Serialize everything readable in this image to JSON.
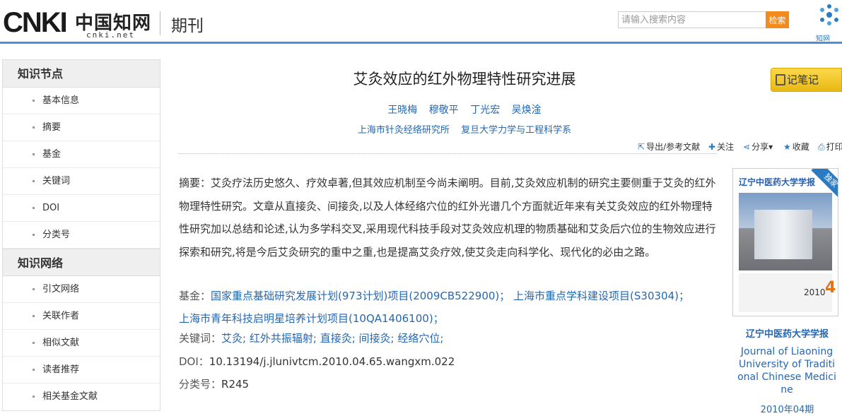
{
  "header": {
    "logo_en": "CNKI",
    "logo_cn": "中国知网",
    "logo_domain": "cnki.net",
    "section": "期刊",
    "search_placeholder": "请输入搜索内容",
    "search_button": "检索",
    "corner_logo_text": "知网"
  },
  "sidebar": {
    "groups": [
      {
        "title": "知识节点",
        "items": [
          "基本信息",
          "摘要",
          "基金",
          "关键词",
          "DOI",
          "分类号"
        ]
      },
      {
        "title": "知识网络",
        "items": [
          "引文网络",
          "关联作者",
          "相似文献",
          "读者推荐",
          "相关基金文献"
        ]
      }
    ]
  },
  "article": {
    "title": "艾灸效应的红外物理特性研究进展",
    "authors": [
      "王晓梅",
      "穆敬平",
      "丁光宏",
      "吴焕淦"
    ],
    "orgs": [
      "上海市针灸经络研究所",
      "复旦大学力学与工程科学系"
    ],
    "note_button": "记笔记",
    "toolbar": {
      "export": "导出/参考文献",
      "follow": "关注",
      "share": "分享",
      "favorite": "收藏",
      "print": "打印"
    },
    "abstract_label": "摘要：",
    "abstract": "艾灸疗法历史悠久、疗效卓著,但其效应机制至今尚未阐明。目前,艾灸效应机制的研究主要侧重于艾灸的红外物理特性研究。文章从直接灸、间接灸,以及人体经络穴位的红外光谱几个方面就近年来有关艾灸效应的红外物理特性研究加以总结和论述,认为多学科交叉,采用现代科技手段对艾灸效应机理的物质基础和艾灸后穴位的生物效应进行探索和研究,将是今后艾灸研究的重中之重,也是提高艾灸疗效,使艾灸走向科学化、现代化的必由之路。",
    "fund_label": "基金：",
    "funds": [
      "国家重点基础研究发展计划(973计划)项目(2009CB522900)；",
      "上海市重点学科建设项目(S30304)；",
      "上海市青年科技启明星培养计划项目(10QA1406100)；"
    ],
    "keyword_label": "关键词：",
    "keywords": [
      "艾灸;",
      "红外共振辐射;",
      "直接灸;",
      "间接灸;",
      "经络穴位;"
    ],
    "doi_label": "DOI：",
    "doi": "10.13194/j.jlunivtcm.2010.04.65.wangxm.022",
    "class_label": "分类号：",
    "class_no": "R245"
  },
  "journal": {
    "cover_title": "辽宁中医药大学学报",
    "cover_badge": "独家",
    "cover_year": "2010",
    "cover_issue": "4",
    "name_cn": "辽宁中医药大学学报",
    "name_en": "Journal of Liaoning University of Traditional Chinese Medicine",
    "date": "2010年04期"
  },
  "colors": {
    "link": "#2467b3",
    "accent": "#f28b1c",
    "rule": "#4a90d9",
    "note": "#fcd94b"
  }
}
